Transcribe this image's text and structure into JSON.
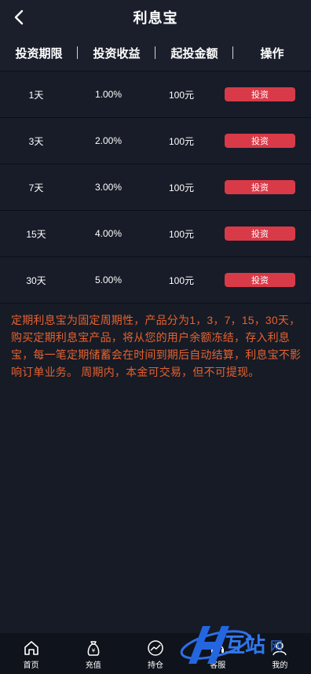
{
  "header": {
    "title": "利息宝",
    "back_icon": "chevron-left-icon"
  },
  "table": {
    "columns": [
      "投资期限",
      "投资收益",
      "起投金额",
      "操作"
    ],
    "rows": [
      {
        "term": "1天",
        "rate": "1.00%",
        "min": "100元",
        "action": "投资"
      },
      {
        "term": "3天",
        "rate": "2.00%",
        "min": "100元",
        "action": "投资"
      },
      {
        "term": "7天",
        "rate": "3.00%",
        "min": "100元",
        "action": "投资"
      },
      {
        "term": "15天",
        "rate": "4.00%",
        "min": "100元",
        "action": "投资"
      },
      {
        "term": "30天",
        "rate": "5.00%",
        "min": "100元",
        "action": "投资"
      }
    ]
  },
  "description": "定期利息宝为固定周期性，产品分为1，3，7，15，30天，购买定期利息宝产品，将从您的用户余额冻结，存入利息宝，每一笔定期储蓄会在时间到期后自动结算，利息宝不影响订单业务。 周期内，本金可交易，但不可提现。",
  "tabbar": [
    {
      "label": "首页",
      "icon": "home-icon"
    },
    {
      "label": "充值",
      "icon": "money-bag-icon"
    },
    {
      "label": "持仓",
      "icon": "trend-chart-icon"
    },
    {
      "label": "客服",
      "icon": "customer-service-icon"
    },
    {
      "label": "我的",
      "icon": "user-icon"
    }
  ],
  "watermark": {
    "text": "互站",
    "sub": "网"
  },
  "colors": {
    "background": "#161b26",
    "header": "#1a1f2b",
    "invest_button": "#d93a48",
    "description_text": "#e6612e"
  }
}
